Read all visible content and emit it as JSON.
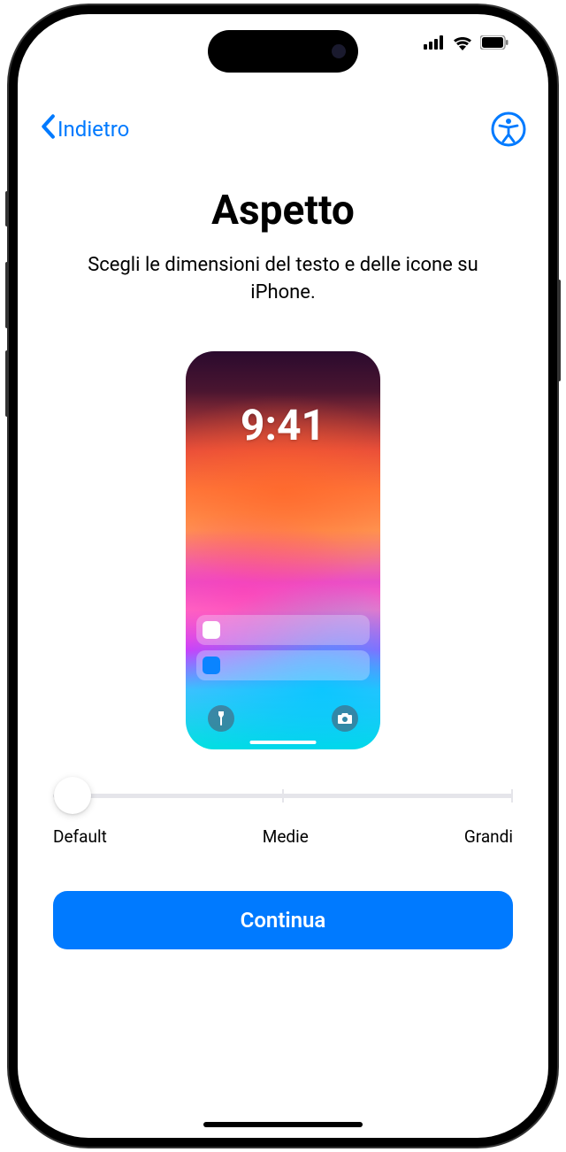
{
  "nav": {
    "back_label": "Indietro"
  },
  "page": {
    "title": "Aspetto",
    "subtitle": "Scegli le dimensioni del testo e delle icone su iPhone."
  },
  "preview": {
    "time": "9:41"
  },
  "slider": {
    "labels": {
      "min": "Default",
      "mid": "Medie",
      "max": "Grandi"
    }
  },
  "buttons": {
    "continue": "Continua"
  }
}
